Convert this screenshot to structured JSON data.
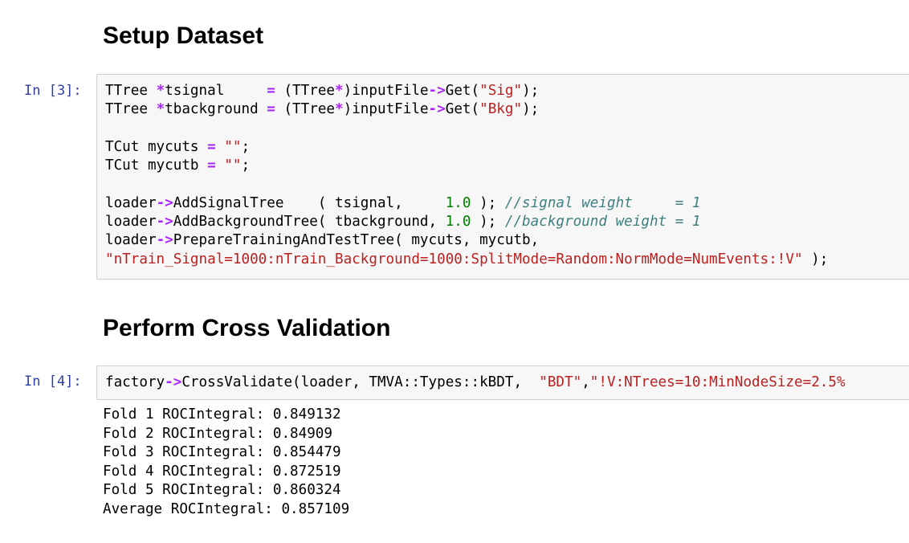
{
  "headings": {
    "setup": "Setup Dataset",
    "cross_validation": "Perform Cross Validation"
  },
  "cells": {
    "cell3": {
      "prompt": "In [3]:",
      "lines": [
        [
          {
            "t": "TTree ",
            "c": "plain"
          },
          {
            "t": "*",
            "c": "op"
          },
          {
            "t": "tsignal     ",
            "c": "plain"
          },
          {
            "t": "=",
            "c": "op"
          },
          {
            "t": " (TTree",
            "c": "plain"
          },
          {
            "t": "*",
            "c": "op"
          },
          {
            "t": ")inputFile",
            "c": "plain"
          },
          {
            "t": "->",
            "c": "op"
          },
          {
            "t": "Get(",
            "c": "plain"
          },
          {
            "t": "\"Sig\"",
            "c": "str"
          },
          {
            "t": ");",
            "c": "plain"
          }
        ],
        [
          {
            "t": "TTree ",
            "c": "plain"
          },
          {
            "t": "*",
            "c": "op"
          },
          {
            "t": "tbackground ",
            "c": "plain"
          },
          {
            "t": "=",
            "c": "op"
          },
          {
            "t": " (TTree",
            "c": "plain"
          },
          {
            "t": "*",
            "c": "op"
          },
          {
            "t": ")inputFile",
            "c": "plain"
          },
          {
            "t": "->",
            "c": "op"
          },
          {
            "t": "Get(",
            "c": "plain"
          },
          {
            "t": "\"Bkg\"",
            "c": "str"
          },
          {
            "t": ");",
            "c": "plain"
          }
        ],
        [],
        [
          {
            "t": "TCut mycuts ",
            "c": "plain"
          },
          {
            "t": "=",
            "c": "op"
          },
          {
            "t": " ",
            "c": "plain"
          },
          {
            "t": "\"\"",
            "c": "str"
          },
          {
            "t": ";",
            "c": "plain"
          }
        ],
        [
          {
            "t": "TCut mycutb ",
            "c": "plain"
          },
          {
            "t": "=",
            "c": "op"
          },
          {
            "t": " ",
            "c": "plain"
          },
          {
            "t": "\"\"",
            "c": "str"
          },
          {
            "t": ";",
            "c": "plain"
          }
        ],
        [],
        [
          {
            "t": "loader",
            "c": "plain"
          },
          {
            "t": "->",
            "c": "op"
          },
          {
            "t": "AddSignalTree    ( tsignal,     ",
            "c": "plain"
          },
          {
            "t": "1.0",
            "c": "num"
          },
          {
            "t": " ); ",
            "c": "plain"
          },
          {
            "t": "//signal weight     = 1",
            "c": "cm"
          }
        ],
        [
          {
            "t": "loader",
            "c": "plain"
          },
          {
            "t": "->",
            "c": "op"
          },
          {
            "t": "AddBackgroundTree( tbackground, ",
            "c": "plain"
          },
          {
            "t": "1.0",
            "c": "num"
          },
          {
            "t": " ); ",
            "c": "plain"
          },
          {
            "t": "//background weight = 1",
            "c": "cm"
          }
        ],
        [
          {
            "t": "loader",
            "c": "plain"
          },
          {
            "t": "->",
            "c": "op"
          },
          {
            "t": "PrepareTrainingAndTestTree( mycuts, mycutb,",
            "c": "plain"
          }
        ],
        [
          {
            "t": "\"nTrain_Signal=1000:nTrain_Background=1000:SplitMode=Random:NormMode=NumEvents:!V\"",
            "c": "str"
          },
          {
            "t": " );",
            "c": "plain"
          }
        ]
      ]
    },
    "cell4": {
      "prompt": "In [4]:",
      "lines": [
        [
          {
            "t": "factory",
            "c": "plain"
          },
          {
            "t": "->",
            "c": "op"
          },
          {
            "t": "CrossValidate(loader, TMVA::Types::kBDT,  ",
            "c": "plain"
          },
          {
            "t": "\"BDT\"",
            "c": "str"
          },
          {
            "t": ",",
            "c": "plain"
          },
          {
            "t": "\"!V:NTrees=10:MinNodeSize=2.5%",
            "c": "str"
          }
        ]
      ],
      "output": [
        "Fold 1 ROCIntegral: 0.849132",
        "Fold 2 ROCIntegral: 0.84909",
        "Fold 3 ROCIntegral: 0.854479",
        "Fold 4 ROCIntegral: 0.872519",
        "Fold 5 ROCIntegral: 0.860324",
        "Average ROCIntegral: 0.857109"
      ]
    }
  },
  "colors": {
    "prompt": "#303F9F",
    "operator": "#aa22ff",
    "string": "#ba2121",
    "number": "#008000",
    "comment": "#408080",
    "cell_background": "#f7f7f7",
    "cell_border": "#cfcfcf"
  }
}
